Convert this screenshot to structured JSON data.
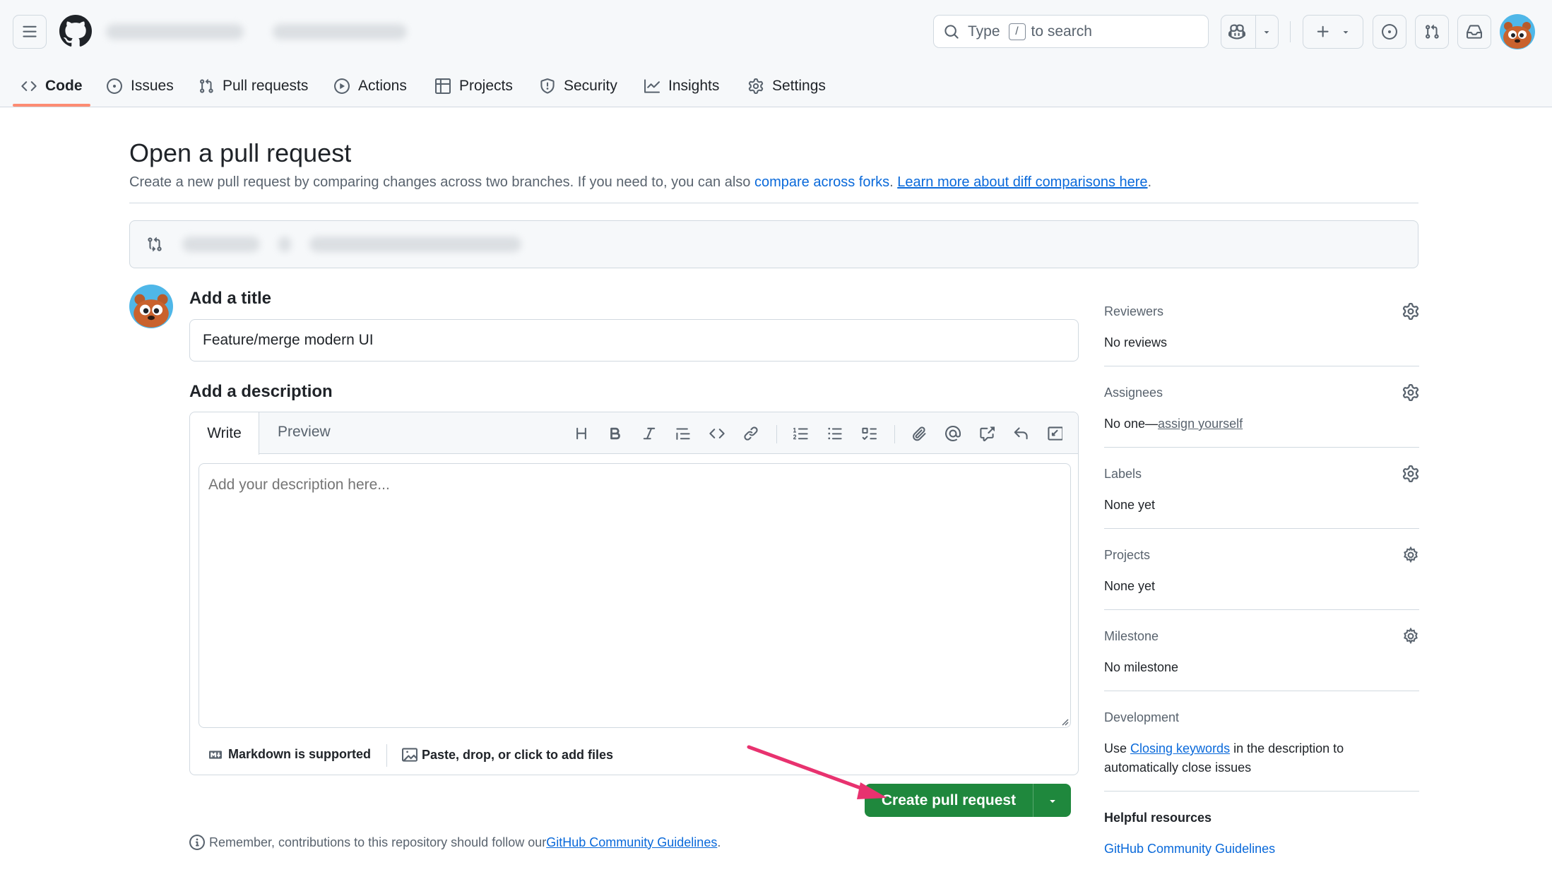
{
  "header": {
    "search_prefix": "Type",
    "search_key": "/",
    "search_suffix": "to search",
    "colors": {
      "background": "#f6f8fa",
      "border": "#d1d9e0",
      "active_tab": "#fd8c73"
    }
  },
  "repo_nav": {
    "tabs": [
      {
        "label": "Code",
        "icon": "code-icon",
        "active": true
      },
      {
        "label": "Issues",
        "icon": "issue-opened-icon"
      },
      {
        "label": "Pull requests",
        "icon": "git-pull-request-icon"
      },
      {
        "label": "Actions",
        "icon": "play-icon"
      },
      {
        "label": "Projects",
        "icon": "table-icon"
      },
      {
        "label": "Security",
        "icon": "shield-icon"
      },
      {
        "label": "Insights",
        "icon": "graph-icon"
      },
      {
        "label": "Settings",
        "icon": "gear-icon"
      }
    ]
  },
  "page": {
    "title": "Open a pull request",
    "subtitle_text": "Create a new pull request by comparing changes across two branches. If you need to, you can also ",
    "compare_forks_link": "compare across forks",
    "subtitle_period": ".",
    "learn_more_link": "Learn more about diff comparisons here",
    "learn_more_period": "."
  },
  "form": {
    "title_label": "Add a title",
    "title_value": "Feature/merge modern UI",
    "description_label": "Add a description",
    "tab_write": "Write",
    "tab_preview": "Preview",
    "description_placeholder": "Add your description here...",
    "markdown_note": "Markdown is supported",
    "attach_note": "Paste, drop, or click to add files",
    "toolbar_icons": [
      "heading-icon",
      "bold-icon",
      "italic-icon",
      "quote-icon",
      "code-icon",
      "link-icon",
      "ordered-list-icon",
      "unordered-list-icon",
      "task-list-icon",
      "paperclip-icon",
      "mention-icon",
      "cross-reference-icon",
      "reply-icon",
      "slash-command-icon"
    ],
    "create_button": "Create pull request",
    "guidelines_prefix": "Remember, contributions to this repository should follow our ",
    "guidelines_link": "GitHub Community Guidelines",
    "guidelines_suffix": ".",
    "colors": {
      "primary_button": "#1f883d",
      "link": "#0969da",
      "annotation_arrow": "#e8326f"
    }
  },
  "sidebar": {
    "reviewers": {
      "heading": "Reviewers",
      "value": "No reviews"
    },
    "assignees": {
      "heading": "Assignees",
      "value_prefix": "No one—",
      "value_link": "assign yourself"
    },
    "labels": {
      "heading": "Labels",
      "value": "None yet"
    },
    "projects": {
      "heading": "Projects",
      "value": "None yet"
    },
    "milestone": {
      "heading": "Milestone",
      "value": "No milestone"
    },
    "development": {
      "heading": "Development",
      "text_prefix": "Use ",
      "link": "Closing keywords",
      "text_suffix": " in the description to automatically close issues"
    },
    "helpful_resources": {
      "heading": "Helpful resources",
      "link": "GitHub Community Guidelines"
    }
  }
}
